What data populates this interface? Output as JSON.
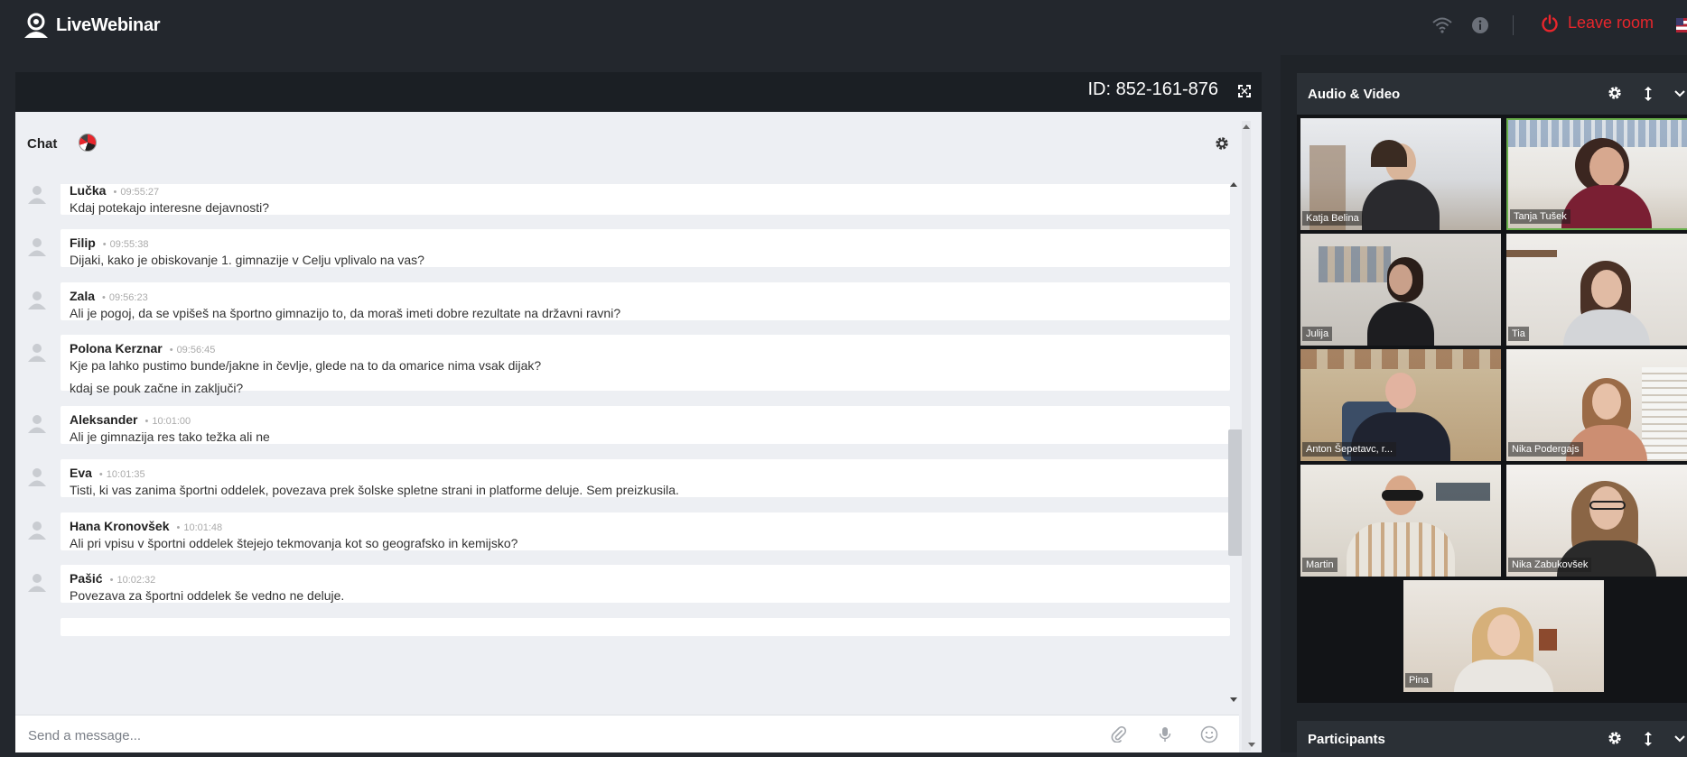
{
  "app": {
    "brand": "LiveWebinar"
  },
  "topbar": {
    "leave_label": "Leave room"
  },
  "stage": {
    "meeting_id": "ID: 852-161-876"
  },
  "chat": {
    "title": "Chat",
    "input_placeholder": "Send a message...",
    "messages": [
      {
        "name": "Lučka",
        "time": "09:55:27",
        "text": "Kdaj potekajo interesne dejavnosti?"
      },
      {
        "name": "Filip",
        "time": "09:55:38",
        "text": "Dijaki, kako je obiskovanje 1. gimnazije v Celju vplivalo na vas?"
      },
      {
        "name": "Zala",
        "time": "09:56:23",
        "text": "Ali je pogoj, da se vpišeš na športno gimnazijo to, da moraš imeti dobre rezultate na državni ravni?"
      },
      {
        "name": "Polona Kerznar",
        "time": "09:56:45",
        "text": "Kje pa lahko pustimo bunde/jakne in čevlje, glede na to da omarice nima vsak dijak?",
        "text2": "kdaj se pouk začne in zaključi?"
      },
      {
        "name": "Aleksander",
        "time": "10:01:00",
        "text": "Ali je gimnazija res tako težka ali ne"
      },
      {
        "name": "Eva",
        "time": "10:01:35",
        "text": "Tisti, ki vas zanima športni oddelek, povezava prek šolske spletne strani in platforme deluje. Sem preizkusila."
      },
      {
        "name": "Hana Kronovšek",
        "time": "10:01:48",
        "text": "Ali pri vpisu v športni oddelek štejejo tekmovanja kot so geografsko in kemijsko?"
      },
      {
        "name": "Pašić",
        "time": "10:02:32",
        "text": "Povezava za športni oddelek še vedno ne deluje."
      }
    ]
  },
  "av": {
    "title": "Audio & Video",
    "tiles": [
      {
        "name": "Katja Belina"
      },
      {
        "name": "Tanja Tušek"
      },
      {
        "name": "Julija"
      },
      {
        "name": "Tia"
      },
      {
        "name": "Anton Šepetavc, r..."
      },
      {
        "name": "Nika Podergajs"
      },
      {
        "name": "Martin"
      },
      {
        "name": "Nika Zabukovšek"
      },
      {
        "name": "Pina"
      }
    ]
  },
  "participants": {
    "title": "Participants"
  },
  "colors": {
    "leave": "#e8262c",
    "topbar": "#23272d",
    "chat_bg": "#edeff3",
    "active_speaker": "#6ab04c"
  }
}
